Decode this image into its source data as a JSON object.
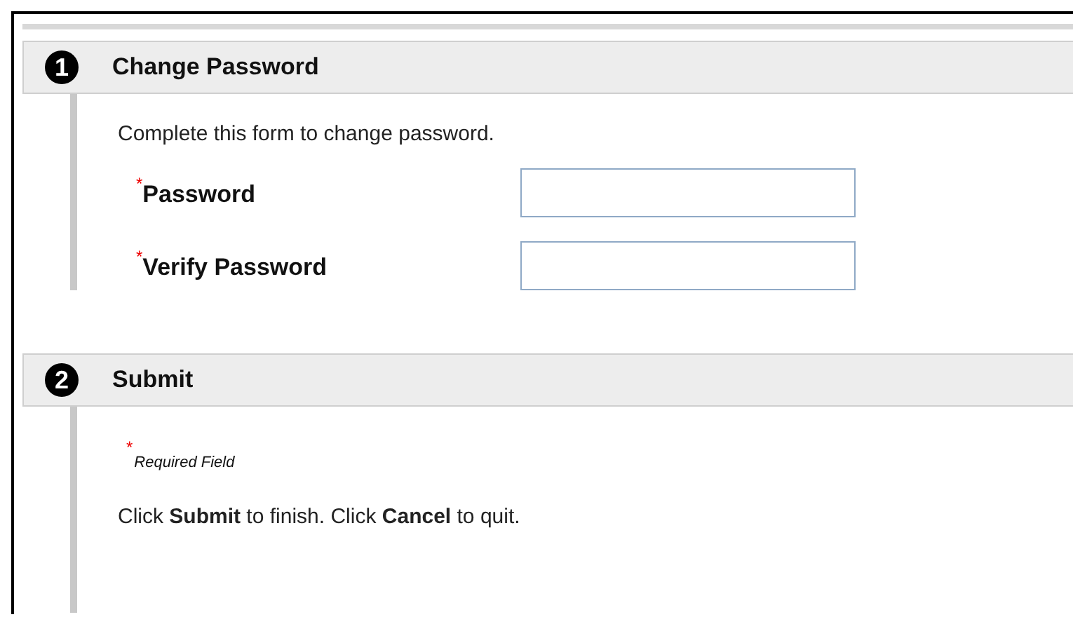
{
  "sections": [
    {
      "number": "1",
      "title": "Change Password",
      "intro": "Complete this form to change password.",
      "fields": [
        {
          "label": "Password",
          "required_mark": "*"
        },
        {
          "label": "Verify Password",
          "required_mark": "*"
        }
      ]
    },
    {
      "number": "2",
      "title": "Submit",
      "required_note": {
        "mark": "*",
        "text": "Required Field"
      },
      "instructions": "Click **Submit** to finish. Click **Cancel** to quit."
    }
  ]
}
